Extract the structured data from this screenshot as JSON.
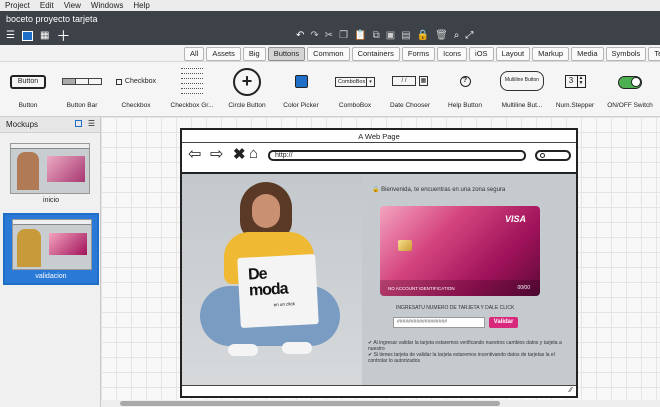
{
  "menubar": {
    "items": [
      "Project",
      "Edit",
      "View",
      "Windows",
      "Help"
    ]
  },
  "window": {
    "title": "boceto proyecto tarjeta"
  },
  "categories": [
    "All",
    "Assets",
    "Big",
    "Buttons",
    "Common",
    "Containers",
    "Forms",
    "Icons",
    "iOS",
    "Layout",
    "Markup",
    "Media",
    "Symbols",
    "Text"
  ],
  "selected_category": "Buttons",
  "palette": [
    {
      "label": "Button",
      "preview": "Button"
    },
    {
      "label": "Button Bar",
      "preview": ""
    },
    {
      "label": "Checkbox",
      "preview": "Checkbox"
    },
    {
      "label": "Checkbox Gr...",
      "preview": ""
    },
    {
      "label": "Circle Button",
      "preview": "+"
    },
    {
      "label": "Color Picker",
      "preview": ""
    },
    {
      "label": "ComboBox",
      "preview": "ComboBox"
    },
    {
      "label": "Date Chooser",
      "preview": "/ /"
    },
    {
      "label": "Help Button",
      "preview": "?"
    },
    {
      "label": "Multiline But...",
      "preview": "Multiline Button"
    },
    {
      "label": "Num.Stepper",
      "preview": "3"
    },
    {
      "label": "ON/OFF Switch",
      "preview": ""
    }
  ],
  "panel": {
    "title": "Mockups"
  },
  "mockups": [
    {
      "name": "inicio"
    },
    {
      "name": "validacion",
      "selected": true
    }
  ],
  "browser": {
    "title": "A Web Page",
    "url": "http://",
    "logo_text": "De moda",
    "logo_sub": "en un click",
    "welcome": "Bienvenida, te encuentras en una zona segura",
    "card_brand": "VISA",
    "card_number": "NO ACCOUNT IDENTIFICATION",
    "card_expiry": "00/00",
    "prompt": "INGRESATU NUMERO DE TARJETA Y DALE CLICK",
    "input_value": "##################",
    "button": "Validar",
    "note1": "Al ingresar validar la tarjeta estaremos verificando nuestros cambios datos y tarjeta a nuestro",
    "note2": "Si tienes tarjeta de validar la tarjeta estaremos incentivando datos de tarjetas la el controlar lo autorizados"
  },
  "colors": {
    "accent": "#d8287c",
    "toolbar": "#3d4248",
    "selection": "#1f6fc8"
  }
}
